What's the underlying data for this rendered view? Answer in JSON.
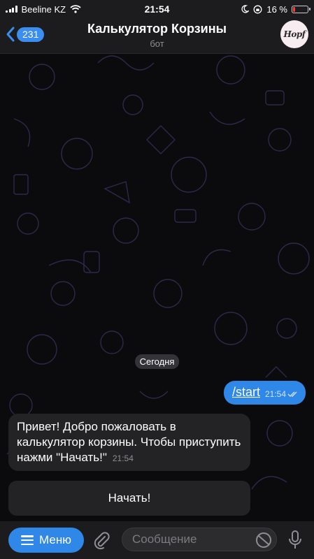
{
  "status_bar": {
    "carrier": "Beeline KZ",
    "time": "21:54",
    "battery_text": "16 %",
    "battery_level": 0.16
  },
  "header": {
    "back_count": "231",
    "title": "Калькулятор Корзины",
    "subtitle": "бот",
    "avatar_text": "Hopf"
  },
  "chat": {
    "date_chip": "Сегодня",
    "outgoing": {
      "text": "/start",
      "time": "21:54"
    },
    "incoming": {
      "text": "Привет! Добро пожаловать в калькулятор корзины. Чтобы приступить нажми \"Начать!\"",
      "time": "21:54"
    },
    "keyboard_button": "Начать!"
  },
  "input_bar": {
    "menu_label": "Меню",
    "placeholder": "Сообщение"
  },
  "colors": {
    "accent": "#2f87e8",
    "bar_bg": "#1c1c1e",
    "bubble_in": "#232326",
    "battery_low": "#ff3b30"
  }
}
